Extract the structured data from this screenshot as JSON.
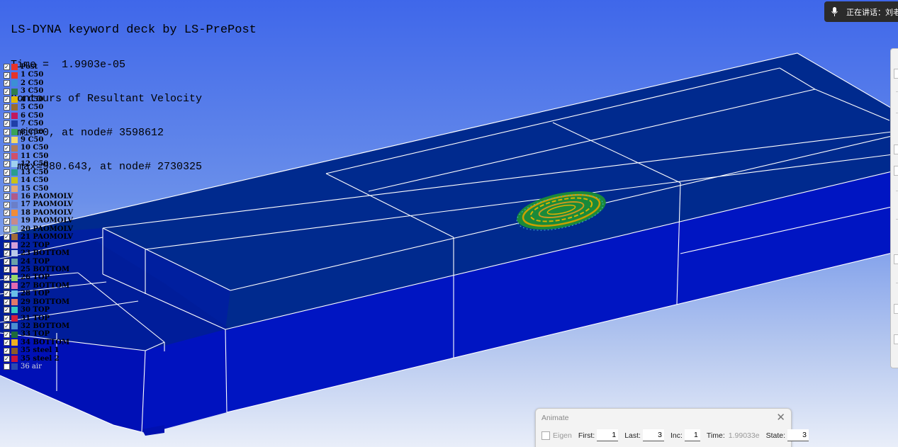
{
  "hud": {
    "title": "LS-DYNA keyword deck by LS-PrePost",
    "time_line": "Time =  1.9903e-05",
    "contour_line": "Contours of Resultant Velocity",
    "min_line": " min=0, at node# 3598612",
    "max_line": " max=980.643, at node# 2730325"
  },
  "legend": {
    "header": "Post",
    "items": [
      {
        "label": "1 C50",
        "color": "#e6332a"
      },
      {
        "label": "2 C50",
        "color": "#3c8fd6"
      },
      {
        "label": "3 C50",
        "color": "#2e7d4f"
      },
      {
        "label": "4 C50",
        "color": "#e0b800"
      },
      {
        "label": "5 C50",
        "color": "#9a6b2f"
      },
      {
        "label": "6 C50",
        "color": "#c2185b"
      },
      {
        "label": "7 C50",
        "color": "#1f3fa8"
      },
      {
        "label": "8 C50",
        "color": "#3aa35a"
      },
      {
        "label": "9 C50",
        "color": "#f5d96b"
      },
      {
        "label": "10 C50",
        "color": "#b07a5a"
      },
      {
        "label": "11 C50",
        "color": "#d0506a"
      },
      {
        "label": "12 C50",
        "color": "#9fd0f0"
      },
      {
        "label": "13 C50",
        "color": "#2a9d8f"
      },
      {
        "label": "14 C50",
        "color": "#c9c21a"
      },
      {
        "label": "15 C50",
        "color": "#e3a877"
      },
      {
        "label": "16 PAOMOLV",
        "color": "#b05a8a"
      },
      {
        "label": "17 PAOMOLV",
        "color": "#6b7fc8"
      },
      {
        "label": "18 PAOMOLV",
        "color": "#f08c3a"
      },
      {
        "label": "19 PAOMOLV",
        "color": "#c78a8a"
      },
      {
        "label": "20 PAOMOLV",
        "color": "#8fc79a"
      },
      {
        "label": "21 PAOMOLV",
        "color": "#a06a3a"
      },
      {
        "label": "22 TOP",
        "color": "#d7a0d8"
      },
      {
        "label": "23 BOTTOM",
        "color": "#b9c9e9"
      },
      {
        "label": "24 TOP",
        "color": "#6aa0a8"
      },
      {
        "label": "25 BOTTOM",
        "color": "#f2a0b8"
      },
      {
        "label": "26 TOP",
        "color": "#98d86a"
      },
      {
        "label": "27 BOTTOM",
        "color": "#e36ab0"
      },
      {
        "label": "28 TOP",
        "color": "#6abfe8"
      },
      {
        "label": "29 BOTTOM",
        "color": "#e07a6a"
      },
      {
        "label": "30 TOP",
        "color": "#38c8c0"
      },
      {
        "label": "31 TOP",
        "color": "#d21f3c"
      },
      {
        "label": "32 BOTTOM",
        "color": "#4a8fd0"
      },
      {
        "label": "33 TOP",
        "color": "#1e6b3a"
      },
      {
        "label": "34 BOTTOM",
        "color": "#f0b020"
      },
      {
        "label": "35 steel 1",
        "color": "#8a5a2a"
      },
      {
        "label": "35 steel 2",
        "color": "#c8143c"
      },
      {
        "label": "36 air",
        "color": "#2a4ab0"
      }
    ]
  },
  "voice": {
    "label": "正在讲话：刘老"
  },
  "animate": {
    "title": "Animate",
    "close": "✕",
    "eigen_label": "Eigen",
    "first_label": "First:",
    "first_value": "1",
    "last_label": "Last:",
    "last_value": "3",
    "inc_label": "Inc:",
    "inc_value": "1",
    "time_label": "Time:",
    "time_value": "1.99033e",
    "state_label": "State:",
    "state_value": "3"
  }
}
